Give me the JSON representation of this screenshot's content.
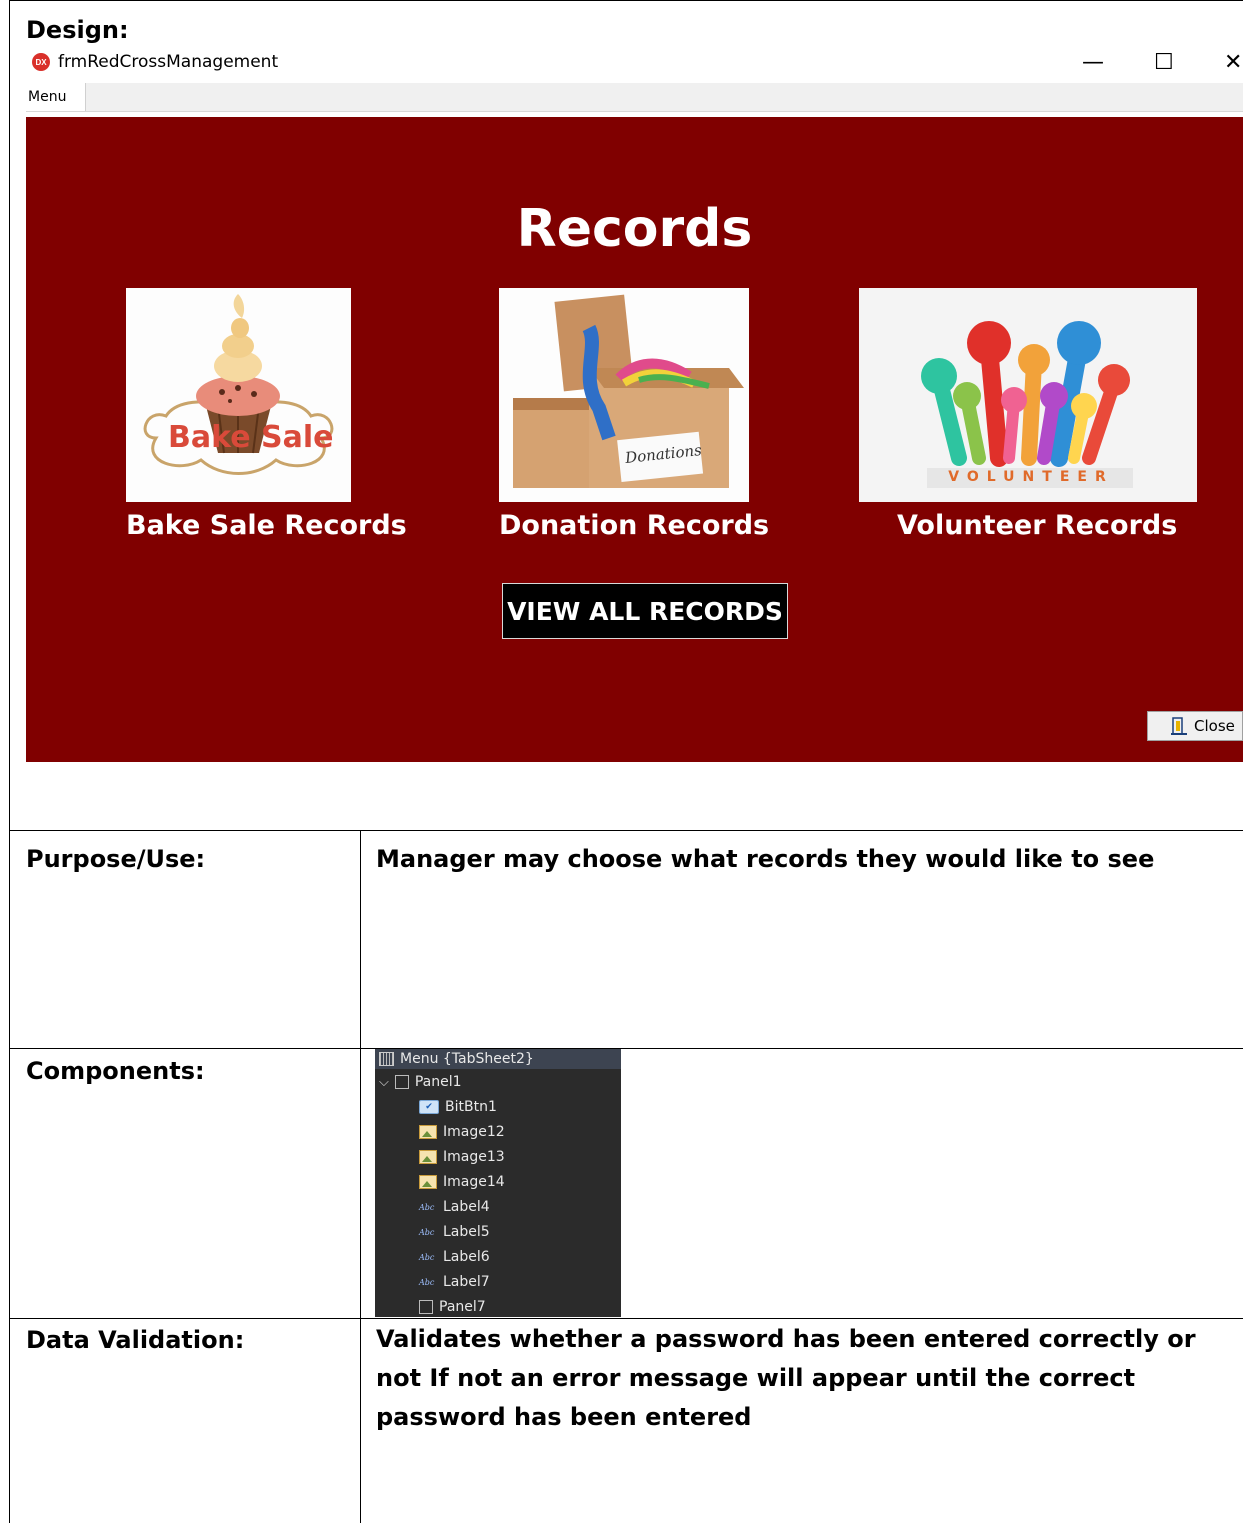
{
  "sections": {
    "design_label": "Design:",
    "purpose_label": "Purpose/Use:",
    "purpose_text": "Manager may choose what records they would like to see",
    "components_label": "Components:",
    "validation_label": "Data Validation:",
    "validation_text": "Validates whether a password has been entered correctly or not If not an error message will appear until the correct password has been entered"
  },
  "window": {
    "app_icon_text": "DX",
    "title": "frmRedCrossManagement",
    "minimize_glyph": "—",
    "maximize_glyph": "☐",
    "close_glyph": "✕",
    "tab_label": "Menu"
  },
  "panel": {
    "heading": "Records",
    "bake_sale_label": "Bake Sale Records",
    "donation_label": "Donation Records",
    "volunteer_label": "Volunteer Records",
    "view_all_label": "VIEW ALL RECORDS",
    "close_label": "Close",
    "bake_sale_image_text": "Bake Sale",
    "donation_image_text": "Donations",
    "volunteer_image_text": "VOLUNTEER"
  },
  "colors": {
    "panel_bg": "#800000",
    "button_bg": "#000000"
  },
  "component_tree": {
    "header": "Menu {TabSheet2}",
    "items": [
      "Panel1",
      "BitBtn1",
      "Image12",
      "Image13",
      "Image14",
      "Label4",
      "Label5",
      "Label6",
      "Label7",
      "Panel7"
    ]
  },
  "icons": [
    "app-icon",
    "door-exit-icon",
    "tree-chevron-icon",
    "tabsheet-icon",
    "panel-icon",
    "bitbtn-icon",
    "image-icon",
    "label-icon"
  ]
}
